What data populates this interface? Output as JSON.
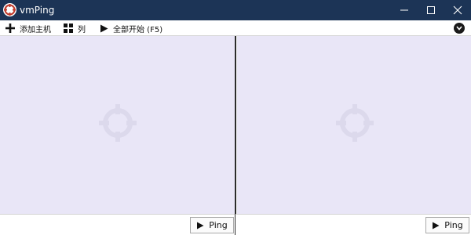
{
  "window": {
    "title": "vmPing"
  },
  "toolbar": {
    "add_host_label": "添加主机",
    "columns_label": "列",
    "start_all_label": "全部开始 (F5)"
  },
  "panes": [
    {
      "ping_label": "Ping"
    },
    {
      "ping_label": "Ping"
    }
  ],
  "icons": {
    "app": "vmping-logo-icon",
    "add": "plus-icon",
    "columns": "grid-icon",
    "start": "play-icon",
    "expand": "chevron-down-icon",
    "watermark": "crosshair-icon"
  },
  "colors": {
    "titlebar": "#1c3456",
    "pane_background": "#e9e6f7",
    "watermark": "#dcd9ec",
    "divider": "#2b2b2b"
  }
}
